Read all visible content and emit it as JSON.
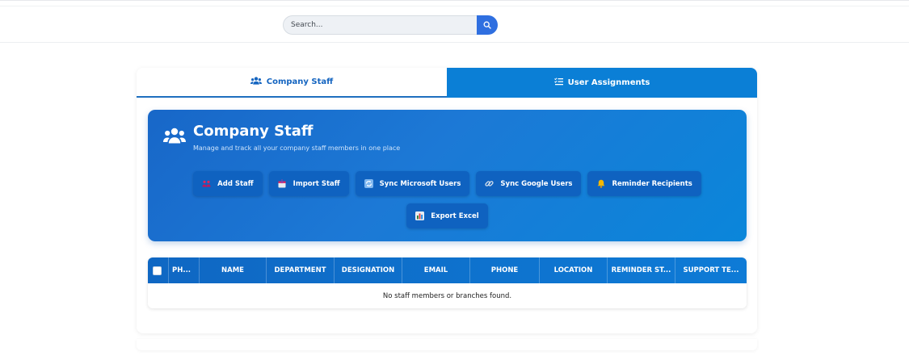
{
  "search": {
    "placeholder": "Search..."
  },
  "tabs": [
    {
      "label": "Company Staff",
      "icon": "users-icon",
      "active": true
    },
    {
      "label": "User Assignments",
      "icon": "list-check-icon",
      "active": false
    }
  ],
  "hero": {
    "title": "Company Staff",
    "subtitle": "Manage and track all your company staff members in one place",
    "buttons": [
      {
        "label": "Add Staff",
        "icon": "user-plus-icon"
      },
      {
        "label": "Import Staff",
        "icon": "import-icon"
      },
      {
        "label": "Sync Microsoft Users",
        "icon": "sync-icon"
      },
      {
        "label": "Sync Google Users",
        "icon": "link-icon"
      },
      {
        "label": "Reminder Recipients",
        "icon": "bell-icon"
      },
      {
        "label": "Export Excel",
        "icon": "excel-icon"
      }
    ]
  },
  "table": {
    "columns": [
      "PH...",
      "NAME",
      "DEPARTMENT",
      "DESIGNATION",
      "EMAIL",
      "PHONE",
      "LOCATION",
      "REMINDER ST...",
      "SUPPORT TE..."
    ],
    "empty_message": "No staff members or branches found."
  },
  "colors": {
    "accent": "#0b7fd6",
    "hero_gradient_start": "#1867c8",
    "hero_gradient_end": "#0a86da",
    "search_button": "#2f6fe0"
  }
}
